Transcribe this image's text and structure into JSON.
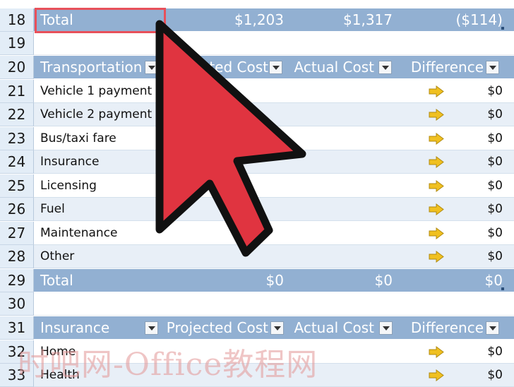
{
  "colors": {
    "header_blue": "#92b0d2",
    "stripe": "#e8eff7",
    "selection": "#e8505a",
    "cursor_red": "#e03440",
    "arrow_gold": "#f0c020"
  },
  "rows": [
    {
      "num": "18",
      "kind": "total",
      "label": "Total",
      "projected": "$1,203",
      "actual": "$1,317",
      "difference": "($114)"
    },
    {
      "num": "19",
      "kind": "empty"
    },
    {
      "num": "20",
      "kind": "header",
      "label": "Transportation",
      "projected": "Projected Cost",
      "actual": "Actual Cost",
      "difference": "Difference"
    },
    {
      "num": "21",
      "kind": "item",
      "label": "Vehicle 1 payment",
      "difference": "$0"
    },
    {
      "num": "22",
      "kind": "item",
      "label": "Vehicle 2 payment",
      "difference": "$0"
    },
    {
      "num": "23",
      "kind": "item",
      "label": "Bus/taxi fare",
      "difference": "$0"
    },
    {
      "num": "24",
      "kind": "item",
      "label": "Insurance",
      "difference": "$0"
    },
    {
      "num": "25",
      "kind": "item",
      "label": "Licensing",
      "difference": "$0"
    },
    {
      "num": "26",
      "kind": "item",
      "label": "Fuel",
      "difference": "$0"
    },
    {
      "num": "27",
      "kind": "item",
      "label": "Maintenance",
      "difference": "$0"
    },
    {
      "num": "28",
      "kind": "item",
      "label": "Other",
      "difference": "$0"
    },
    {
      "num": "29",
      "kind": "total",
      "label": "Total",
      "projected": "$0",
      "actual": "$0",
      "difference": "$0"
    },
    {
      "num": "30",
      "kind": "empty"
    },
    {
      "num": "31",
      "kind": "header",
      "label": "Insurance",
      "projected": "Projected Cost",
      "actual": "Actual Cost",
      "difference": "Difference"
    },
    {
      "num": "32",
      "kind": "item",
      "label": "Home",
      "difference": "$0"
    },
    {
      "num": "33",
      "kind": "item",
      "label": "Health",
      "difference": "$0"
    }
  ],
  "icons": {
    "difference_indicator": "right-arrow-icon",
    "dropdown": "chevron-down-icon",
    "cursor": "mouse-pointer-icon"
  },
  "watermark": "时吧网-Office教程网"
}
